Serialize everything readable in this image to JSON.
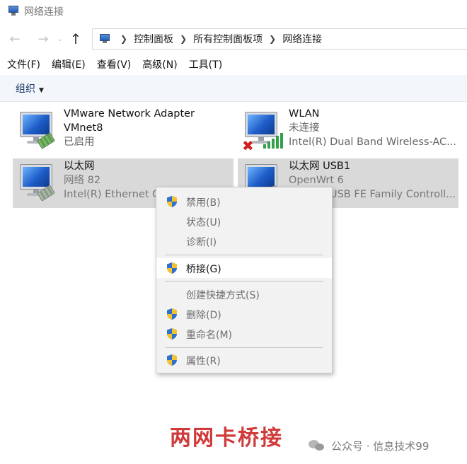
{
  "window": {
    "title": "网络连接"
  },
  "address": {
    "breadcrumbs": [
      "控制面板",
      "所有控制面板项",
      "网络连接"
    ]
  },
  "menubar": {
    "items": [
      "文件(F)",
      "编辑(E)",
      "查看(V)",
      "高级(N)",
      "工具(T)"
    ]
  },
  "toolbar": {
    "organize_label": "组织"
  },
  "adapters": [
    {
      "name": "VMware Network Adapter",
      "line2": "VMnet8",
      "status": "已启用",
      "icon": "ethernet-monitor-icon",
      "selected": false
    },
    {
      "name": "WLAN",
      "line2": "未连接",
      "status": "Intel(R) Dual Band Wireless-AC...",
      "icon": "wifi-monitor-icon",
      "selected": false
    },
    {
      "name": "以太网",
      "line2": "网络 82",
      "status": "Intel(R) Ethernet C",
      "icon": "ethernet-monitor-icon",
      "selected": true
    },
    {
      "name": "以太网 USB1",
      "line2": "OpenWrt 6",
      "status": "USB FE Family Controll...",
      "icon": "ethernet-monitor-icon",
      "selected": true
    }
  ],
  "context_menu": {
    "items": [
      {
        "label": "禁用(B)",
        "shield": true,
        "enabled": false
      },
      {
        "label": "状态(U)",
        "shield": false,
        "enabled": false
      },
      {
        "label": "诊断(I)",
        "shield": false,
        "enabled": false
      },
      {
        "label": "桥接(G)",
        "shield": true,
        "enabled": true,
        "highlighted": true
      },
      {
        "label": "创建快捷方式(S)",
        "shield": false,
        "enabled": false
      },
      {
        "label": "删除(D)",
        "shield": true,
        "enabled": false
      },
      {
        "label": "重命名(M)",
        "shield": true,
        "enabled": false
      },
      {
        "label": "属性(R)",
        "shield": true,
        "enabled": false
      }
    ]
  },
  "caption": "两网卡桥接",
  "watermark": "公众号 · 信息技术99",
  "colors": {
    "accent_red": "#d03a3a",
    "wifi_green": "#35a04a",
    "error_red": "#d02020",
    "toolbar_bg": "#f3f6fb",
    "selection_bg": "#d9d9d9"
  }
}
